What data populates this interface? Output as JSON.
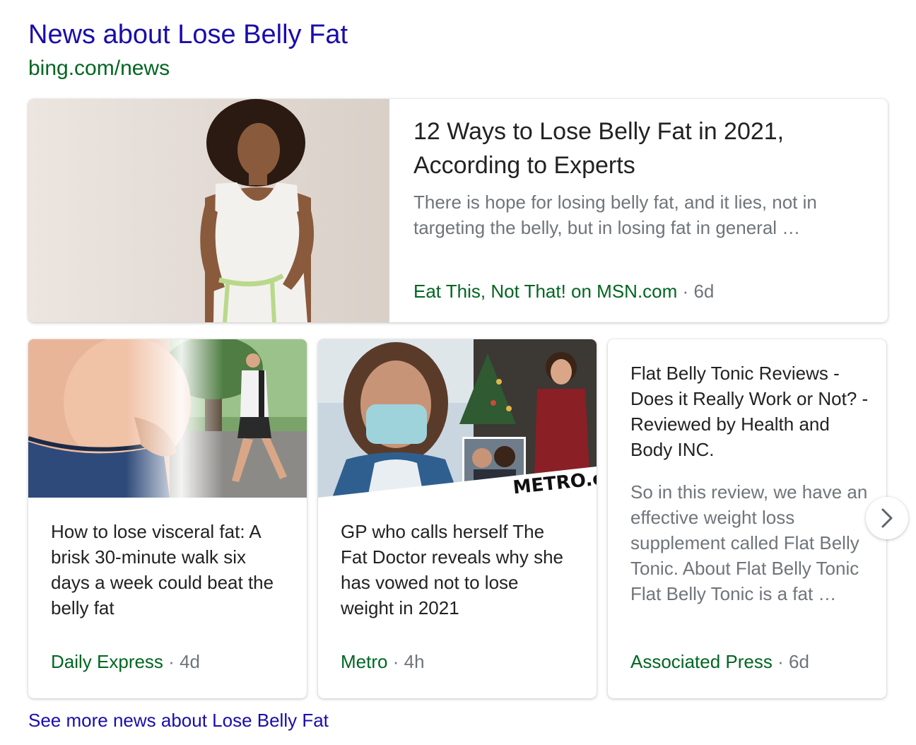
{
  "header": {
    "title": "News about Lose Belly Fat",
    "url": "bing.com/news"
  },
  "featured": {
    "title": "12 Ways to Lose Belly Fat in 2021, According to Experts",
    "snippet": "There is hope for losing belly fat, and it lies, not in targeting the belly, but in losing fat in general …",
    "source": "Eat This, Not That! on MSN.com",
    "separator": "·",
    "age": "6d"
  },
  "cards": [
    {
      "title": "How to lose visceral fat: A brisk 30-minute walk six days a week could beat the belly fat",
      "source": "Daily Express",
      "separator": "·",
      "age": "4d"
    },
    {
      "title": "GP who calls herself The Fat Doctor reveals why she has vowed not to lose weight in 2021",
      "source": "Metro",
      "separator": "·",
      "age": "4h",
      "image_watermark": "METRO.co"
    },
    {
      "title": "Flat Belly Tonic Reviews - Does it Really Work or Not? - Reviewed by Health and Body INC.",
      "snippet": "So in this review, we have an effective weight loss supplement called Flat Belly Tonic. About Flat Belly Tonic Flat Belly Tonic is a fat …",
      "source": "Associated Press",
      "separator": "·",
      "age": "6d"
    }
  ],
  "next_icon": "chevron-right-icon",
  "see_more": "See more news about Lose Belly Fat",
  "colors": {
    "link_blue": "#1a0dab",
    "source_green": "#006621",
    "meta_gray": "#70757a",
    "title_text": "#222222"
  }
}
